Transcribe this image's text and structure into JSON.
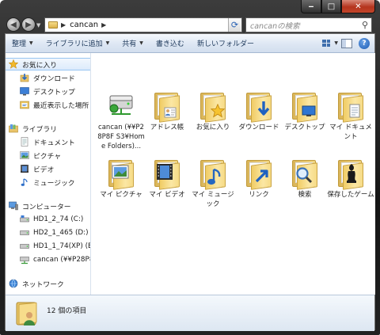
{
  "window": {
    "caption": {
      "minimize": "‒",
      "maximize": "□",
      "close": "✕"
    }
  },
  "address": {
    "crumb": "cancan",
    "search_placeholder": "cancanの検索"
  },
  "toolbar": {
    "organize": "整理",
    "add_to_library": "ライブラリに追加",
    "share": "共有",
    "burn": "書き込む",
    "new_folder": "新しいフォルダー"
  },
  "nav": {
    "favorites": "お気に入り",
    "downloads": "ダウンロード",
    "desktop": "デスクトップ",
    "recent": "最近表示した場所",
    "libraries": "ライブラリ",
    "documents": "ドキュメント",
    "pictures": "ピクチャ",
    "videos": "ビデオ",
    "music": "ミュージック",
    "computer": "コンピューター",
    "drive_c": "HD1_2_74 (C:)",
    "drive_d": "HD2_1_465 (D:)",
    "drive_e": "HD1_1_74(XP) (E:",
    "net_drive": "cancan (¥¥P28P8F",
    "network": "ネットワーク"
  },
  "items": [
    {
      "label": "cancan (¥¥P28P8F S3¥Home Folders)...",
      "icon": "network-drive-icon"
    },
    {
      "label": "アドレス帳",
      "icon": "contacts-folder-icon"
    },
    {
      "label": "お気に入り",
      "icon": "favorites-folder-icon"
    },
    {
      "label": "ダウンロード",
      "icon": "downloads-folder-icon"
    },
    {
      "label": "デスクトップ",
      "icon": "desktop-folder-icon"
    },
    {
      "label": "マイ ドキュメント",
      "icon": "documents-folder-icon"
    },
    {
      "label": "マイ ピクチャ",
      "icon": "pictures-folder-icon"
    },
    {
      "label": "マイ ビデオ",
      "icon": "videos-folder-icon"
    },
    {
      "label": "マイ ミュージック",
      "icon": "music-folder-icon"
    },
    {
      "label": "リンク",
      "icon": "links-folder-icon"
    },
    {
      "label": "検索",
      "icon": "searches-folder-icon"
    },
    {
      "label": "保存したゲーム",
      "icon": "saved-games-folder-icon"
    }
  ],
  "status": {
    "count": "12 個の項目"
  }
}
